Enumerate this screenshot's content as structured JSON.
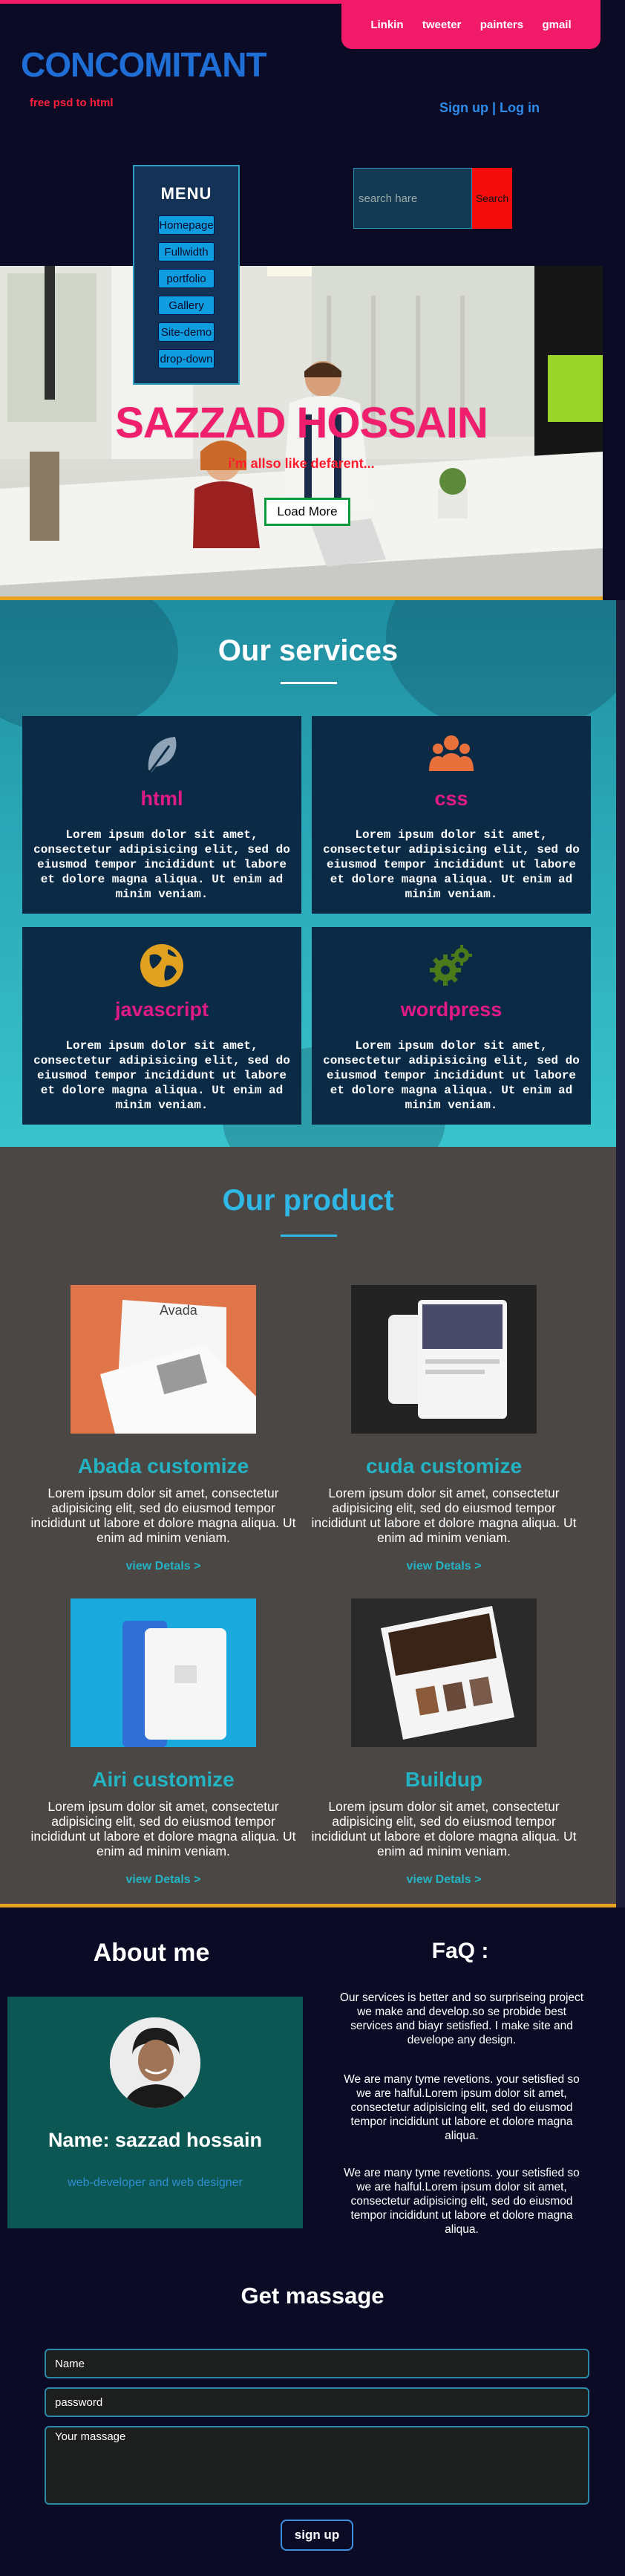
{
  "header": {
    "social": [
      "Linkin",
      "tweeter",
      "painters",
      "gmail"
    ],
    "brand": "CONCOMITANT",
    "tagline": "free psd to html",
    "auth": {
      "signup": "Sign up",
      "separator": " | ",
      "login": "Log in"
    },
    "menu": {
      "title": "MENU",
      "items": [
        "Homepage",
        "Fullwidth",
        "portfolio",
        "Gallery",
        "Site-demo",
        "drop-down"
      ]
    },
    "search": {
      "placeholder": "search hare",
      "button": "Search"
    }
  },
  "hero": {
    "name": "SAZZAD HOSSAIN",
    "subtitle": "i'm allso like defarent...",
    "button": "Load More"
  },
  "services": {
    "title": "Our services",
    "cards": [
      {
        "name": "html",
        "icon": "feather-icon",
        "text": "Lorem ipsum dolor sit amet, consectetur adipisicing elit, sed do eiusmod tempor incididunt ut labore et dolore magna aliqua. Ut enim ad minim veniam."
      },
      {
        "name": "css",
        "icon": "users-icon",
        "text": "Lorem ipsum dolor sit amet, consectetur adipisicing elit, sed do eiusmod tempor incididunt ut labore et dolore magna aliqua. Ut enim ad minim veniam."
      },
      {
        "name": "javascript",
        "icon": "globe-icon",
        "text": "Lorem ipsum dolor sit amet, consectetur adipisicing elit, sed do eiusmod tempor incididunt ut labore et dolore magna aliqua. Ut enim ad minim veniam."
      },
      {
        "name": "wordpress",
        "icon": "gears-icon",
        "text": "Lorem ipsum dolor sit amet, consectetur adipisicing elit, sed do eiusmod tempor incididunt ut labore et dolore magna aliqua. Ut enim ad minim veniam."
      }
    ]
  },
  "products": {
    "title": "Our product",
    "items": [
      {
        "name": "Abada customize",
        "text": "Lorem ipsum dolor sit amet, consectetur adipisicing elit, sed do eiusmod tempor incididunt ut labore et dolore magna aliqua. Ut enim ad minim veniam.",
        "link": "view Detals >"
      },
      {
        "name": "cuda customize",
        "text": "Lorem ipsum dolor sit amet, consectetur adipisicing elit, sed do eiusmod tempor incididunt ut labore et dolore magna aliqua. Ut enim ad minim veniam.",
        "link": "view Detals >"
      },
      {
        "name": "Airi customize",
        "text": "Lorem ipsum dolor sit amet, consectetur adipisicing elit, sed do eiusmod tempor incididunt ut labore et dolore magna aliqua. Ut enim ad minim veniam.",
        "link": "view Detals >"
      },
      {
        "name": "Buildup",
        "text": "Lorem ipsum dolor sit amet, consectetur adipisicing elit, sed do eiusmod tempor incididunt ut labore et dolore magna aliqua. Ut enim ad minim veniam.",
        "link": "view Detals >"
      }
    ]
  },
  "about": {
    "title": "About me",
    "name": "Name: sazzad hossain",
    "role": "web-developer and web designer"
  },
  "faq": {
    "title": "FaQ :",
    "items": [
      "Our services is better and so surpriseing project we make and develop.so se probide best services and biayr setisfied. I make site and develope any design.",
      "We are many tyme revetions. your setisfied so we are halful.Lorem ipsum dolor sit amet, consectetur adipisicing elit, sed do eiusmod tempor incididunt ut labore et dolore magna aliqua.",
      "We are many tyme revetions. your setisfied so we are halful.Lorem ipsum dolor sit amet, consectetur adipisicing elit, sed do eiusmod tempor incididunt ut labore et dolore magna aliqua."
    ]
  },
  "contact": {
    "title": "Get massage",
    "name_placeholder": "Name",
    "password_placeholder": "password",
    "message_placeholder": "Your massage",
    "button": "sign up"
  },
  "colors": {
    "accent_pink": "#f21b6a",
    "brand_blue": "#1f6ed6",
    "teal": "#23b3c2",
    "orange_line": "#e6a21e"
  }
}
